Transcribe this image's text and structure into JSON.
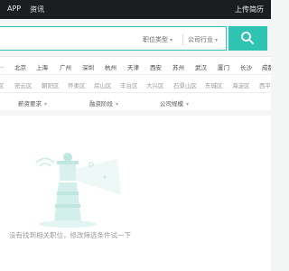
{
  "topbar": {
    "nav": [
      "APP",
      "资讯"
    ],
    "upload": "上传简历"
  },
  "search": {
    "position_type": "职位类型",
    "industry": "公司行业"
  },
  "cities": [
    "北京",
    "上海",
    "广州",
    "深圳",
    "杭州",
    "天津",
    "西安",
    "苏州",
    "武汉",
    "厦门",
    "长沙",
    "成都"
  ],
  "districts": [
    "密云区",
    "朝阳区",
    "怀柔区",
    "房山区",
    "丰台区",
    "大兴区",
    "石景山区",
    "东城区",
    "海淀区",
    "西平"
  ],
  "selectors": {
    "salary": "薪资要求",
    "stage": "融资阶段",
    "scale": "公司规模"
  },
  "empty_message": "没有找到相关职位，修改筛选条件试一下",
  "colors": {
    "accent": "#2fc4b2",
    "topbar": "#1b1e20"
  }
}
